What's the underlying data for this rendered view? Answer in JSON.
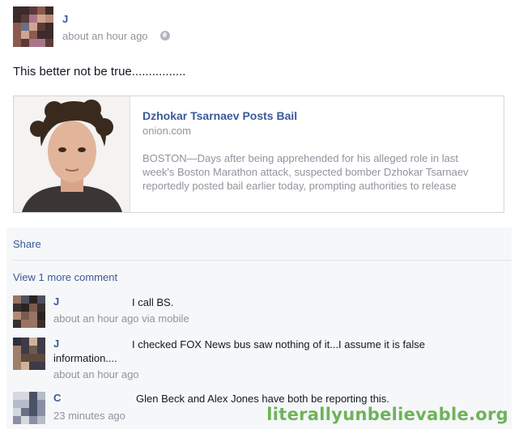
{
  "post": {
    "author": "J",
    "timestamp": "about an hour ago",
    "privacy_icon": "globe-icon",
    "text": "This better not be true................"
  },
  "link": {
    "title": "Dzhokar Tsarnaev Posts Bail",
    "domain": "onion.com",
    "description": "BOSTON—Days after being apprehended for his alleged role in last week's Boston Marathon attack, suspected bomber Dzhokar Tsarnaev reportedly posted bail earlier today, prompting authorities to release"
  },
  "actions": {
    "share_label": "Share",
    "view_more_label": "View 1 more comment"
  },
  "comments": [
    {
      "author": "J",
      "text": "I call BS.",
      "meta": "about an hour ago via mobile"
    },
    {
      "author": "J",
      "text": "I checked FOX News bus saw nothing of it...I assume it is false information....",
      "meta": "about an hour ago"
    },
    {
      "author": "C",
      "text": "Glen Beck and Alex Jones have both be reporting this.",
      "meta": "23 minutes ago"
    }
  ],
  "watermark": "literallyunbelievable.org",
  "colors": {
    "link_blue": "#3b5998",
    "meta_gray": "#90949c",
    "panel_bg": "#f6f7f9",
    "watermark_green": "#6eb35a"
  }
}
